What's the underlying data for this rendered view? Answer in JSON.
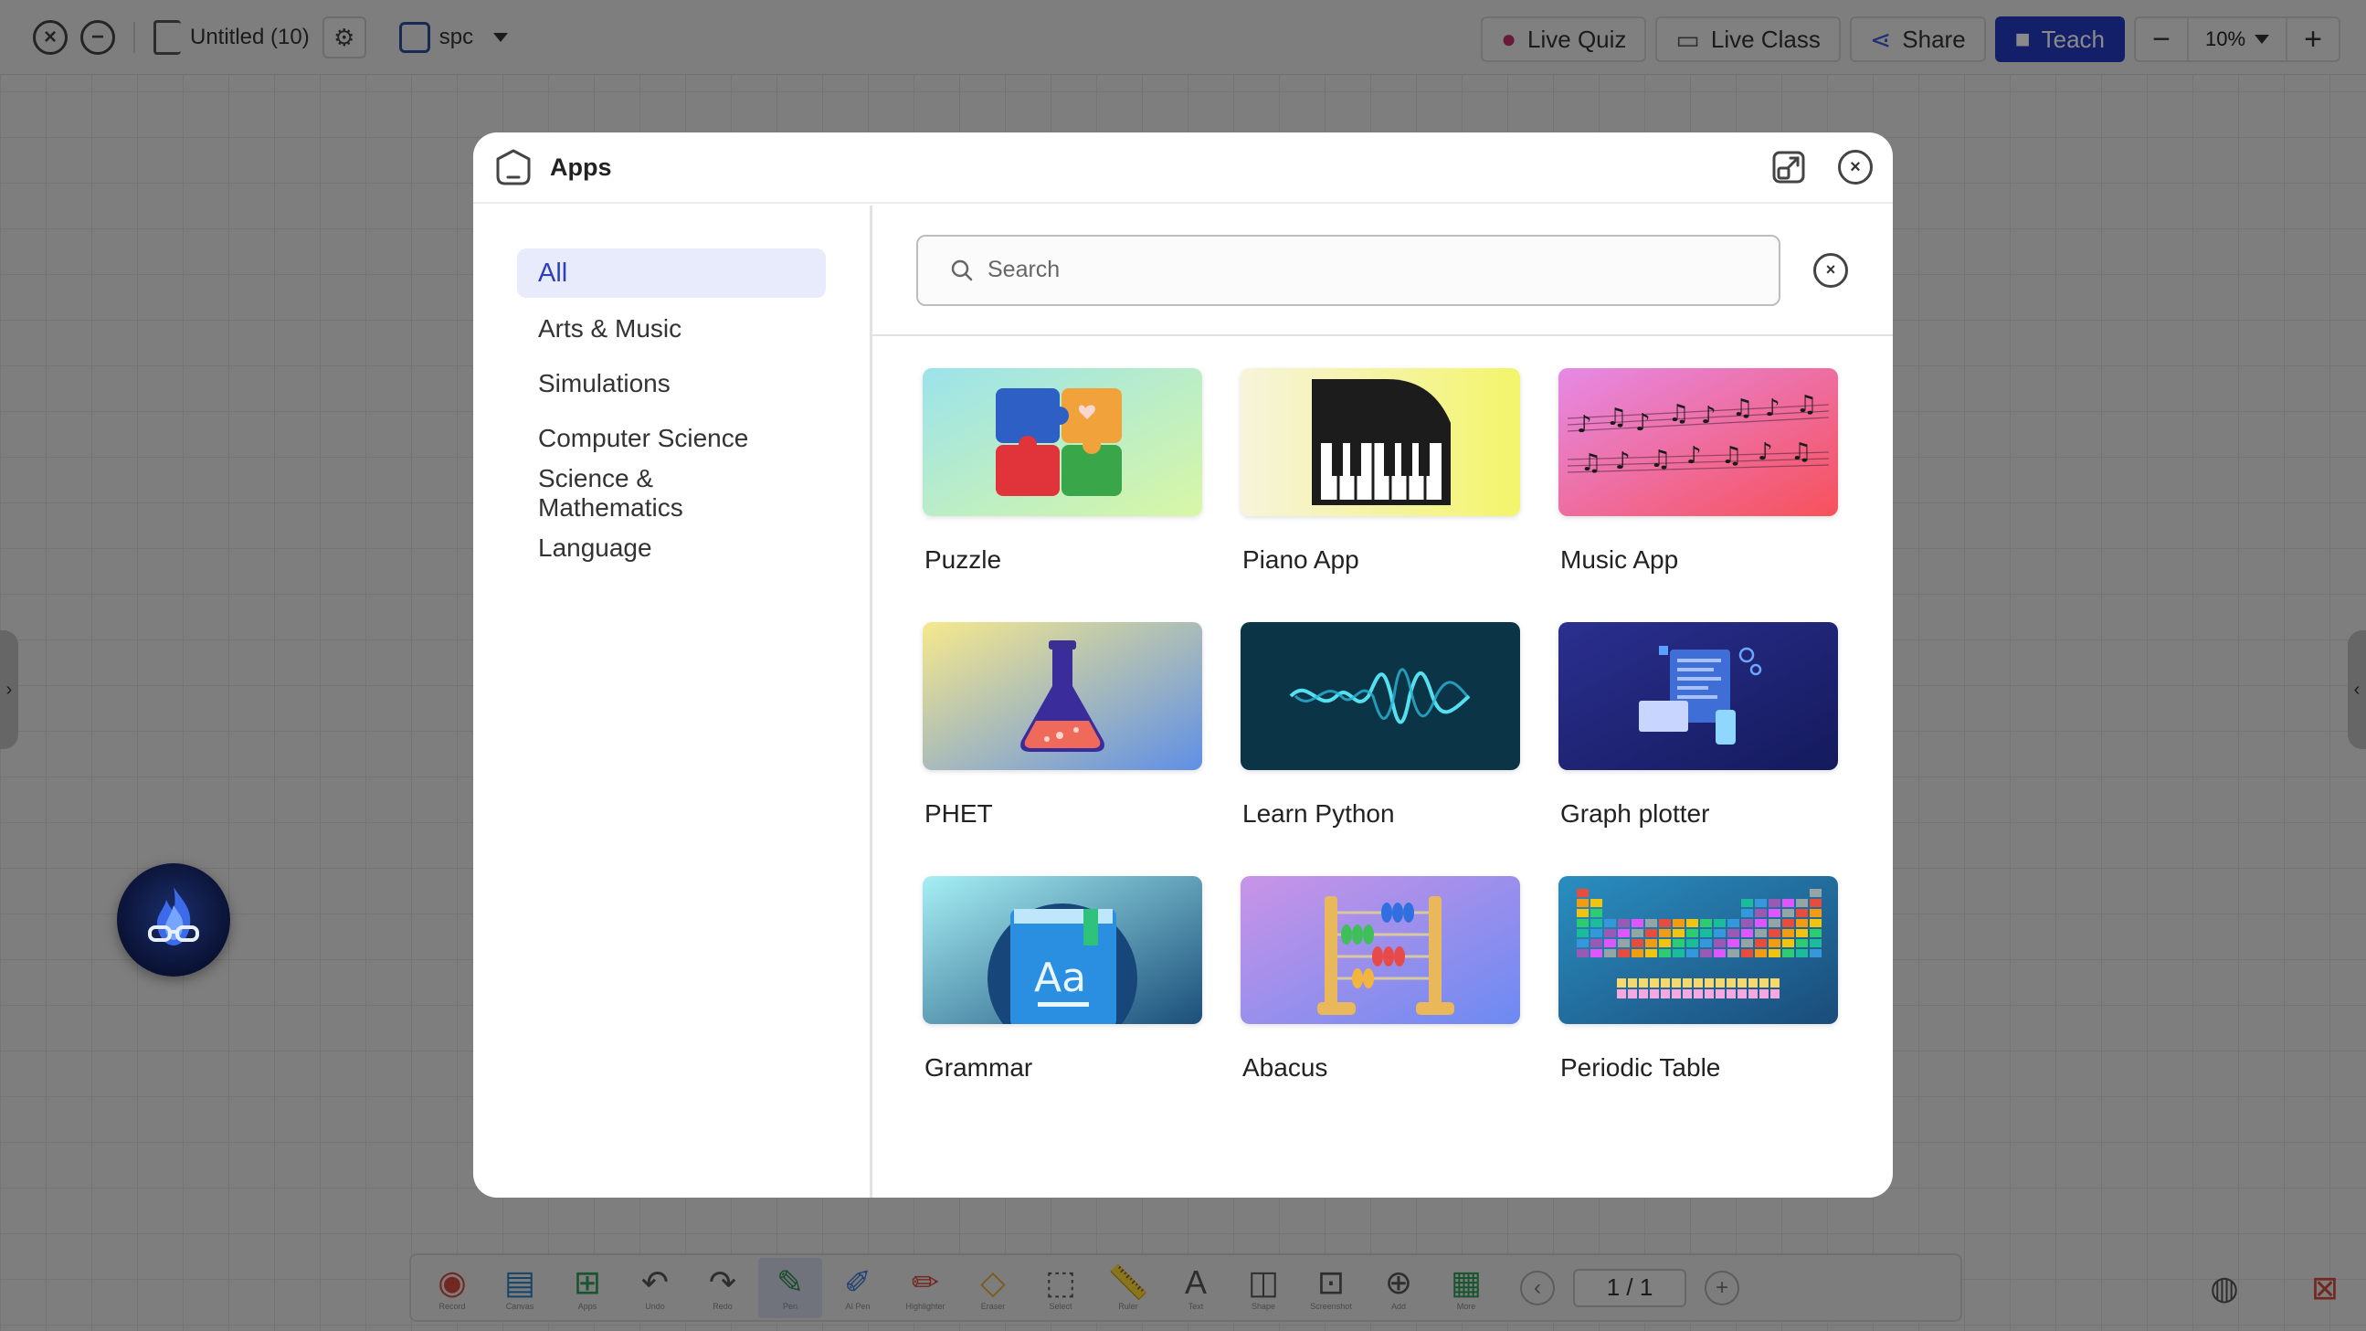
{
  "topbar": {
    "doc_title": "Untitled (10)",
    "profile_name": "spc",
    "buttons": {
      "live_quiz": "Live Quiz",
      "live_class": "Live Class",
      "share": "Share",
      "teach": "Teach"
    },
    "zoom": "10%"
  },
  "modal": {
    "title": "Apps",
    "categories": [
      "All",
      "Arts & Music",
      "Simulations",
      "Computer Science",
      "Science & Mathematics",
      "Language"
    ],
    "selected_category": "All",
    "search_placeholder": "Search",
    "apps": [
      {
        "label": "Puzzle",
        "icon": "puzzle-thumbnail"
      },
      {
        "label": "Piano App",
        "icon": "piano-thumbnail"
      },
      {
        "label": "Music App",
        "icon": "music-notes-thumbnail"
      },
      {
        "label": "PHET",
        "icon": "flask-thumbnail"
      },
      {
        "label": "Learn Python",
        "icon": "waveform-thumbnail"
      },
      {
        "label": "Graph plotter",
        "icon": "devices-thumbnail"
      },
      {
        "label": "Grammar",
        "icon": "book-thumbnail"
      },
      {
        "label": "Abacus",
        "icon": "abacus-thumbnail"
      },
      {
        "label": "Periodic Table",
        "icon": "periodic-table-thumbnail"
      }
    ]
  },
  "bottombar": {
    "page_indicator": "1 / 1",
    "tools": [
      "Record",
      "Canvas",
      "Apps",
      "Undo",
      "Redo",
      "Pen",
      "AI Pen",
      "Highlighter",
      "Eraser",
      "Select",
      "Ruler",
      "Text",
      "Shape",
      "Screenshot",
      "Add",
      "More"
    ]
  },
  "colors": {
    "accent": "#233bc2",
    "selected_category_bg": "#e7ebfb",
    "selected_category_text": "#2f3fb9"
  }
}
